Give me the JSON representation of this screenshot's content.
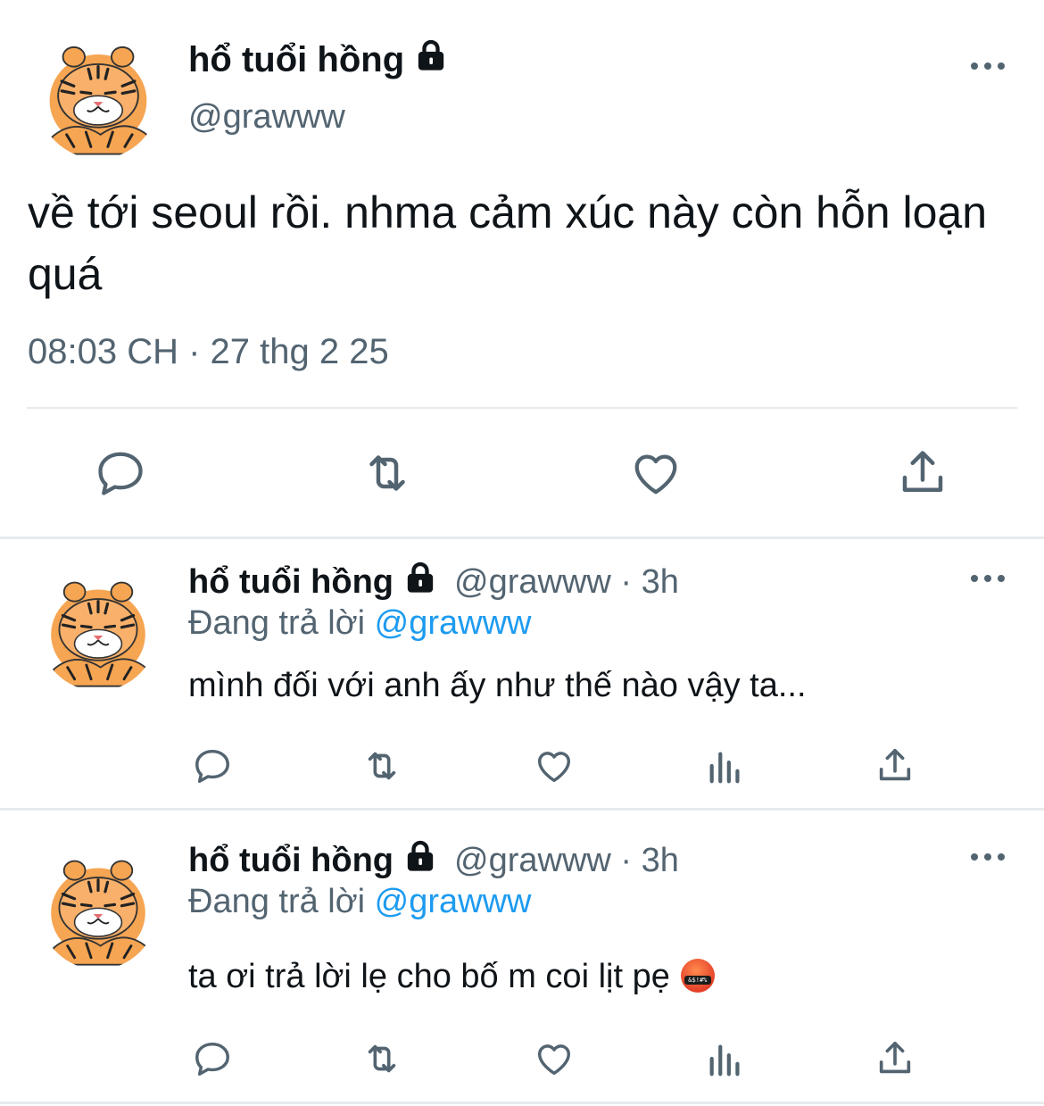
{
  "main_tweet": {
    "display_name": "hổ tuổi hồng",
    "handle": "@grawww",
    "text": "về tới seoul rồi. nhma cảm xúc này còn hỗn loạn quá",
    "timestamp": "08:03 CH · 27 thg 2 25"
  },
  "replies": [
    {
      "display_name": "hổ tuổi hồng",
      "handle_time": "@grawww · 3h",
      "replying_prefix": "Đang trả lời",
      "replying_to": "@grawww",
      "text": "mình đối với anh ấy như thế nào vậy ta..."
    },
    {
      "display_name": "hổ tuổi hồng",
      "handle_time": "@grawww · 3h",
      "replying_prefix": "Đang trả lời",
      "replying_to": "@grawww",
      "text": "ta ơi trả lời lẹ cho bố m coi lịt pẹ"
    }
  ],
  "icons": {
    "reply": "reply-icon",
    "retweet": "retweet-icon",
    "like": "heart-icon",
    "views": "analytics-icon",
    "share": "share-icon",
    "more": "more-icon",
    "lock": "lock-icon",
    "emoji": "cursing-face-emoji"
  },
  "colors": {
    "text": "#0f1419",
    "muted": "#536471",
    "link": "#1d9bf0",
    "divider": "#e7eaee"
  }
}
